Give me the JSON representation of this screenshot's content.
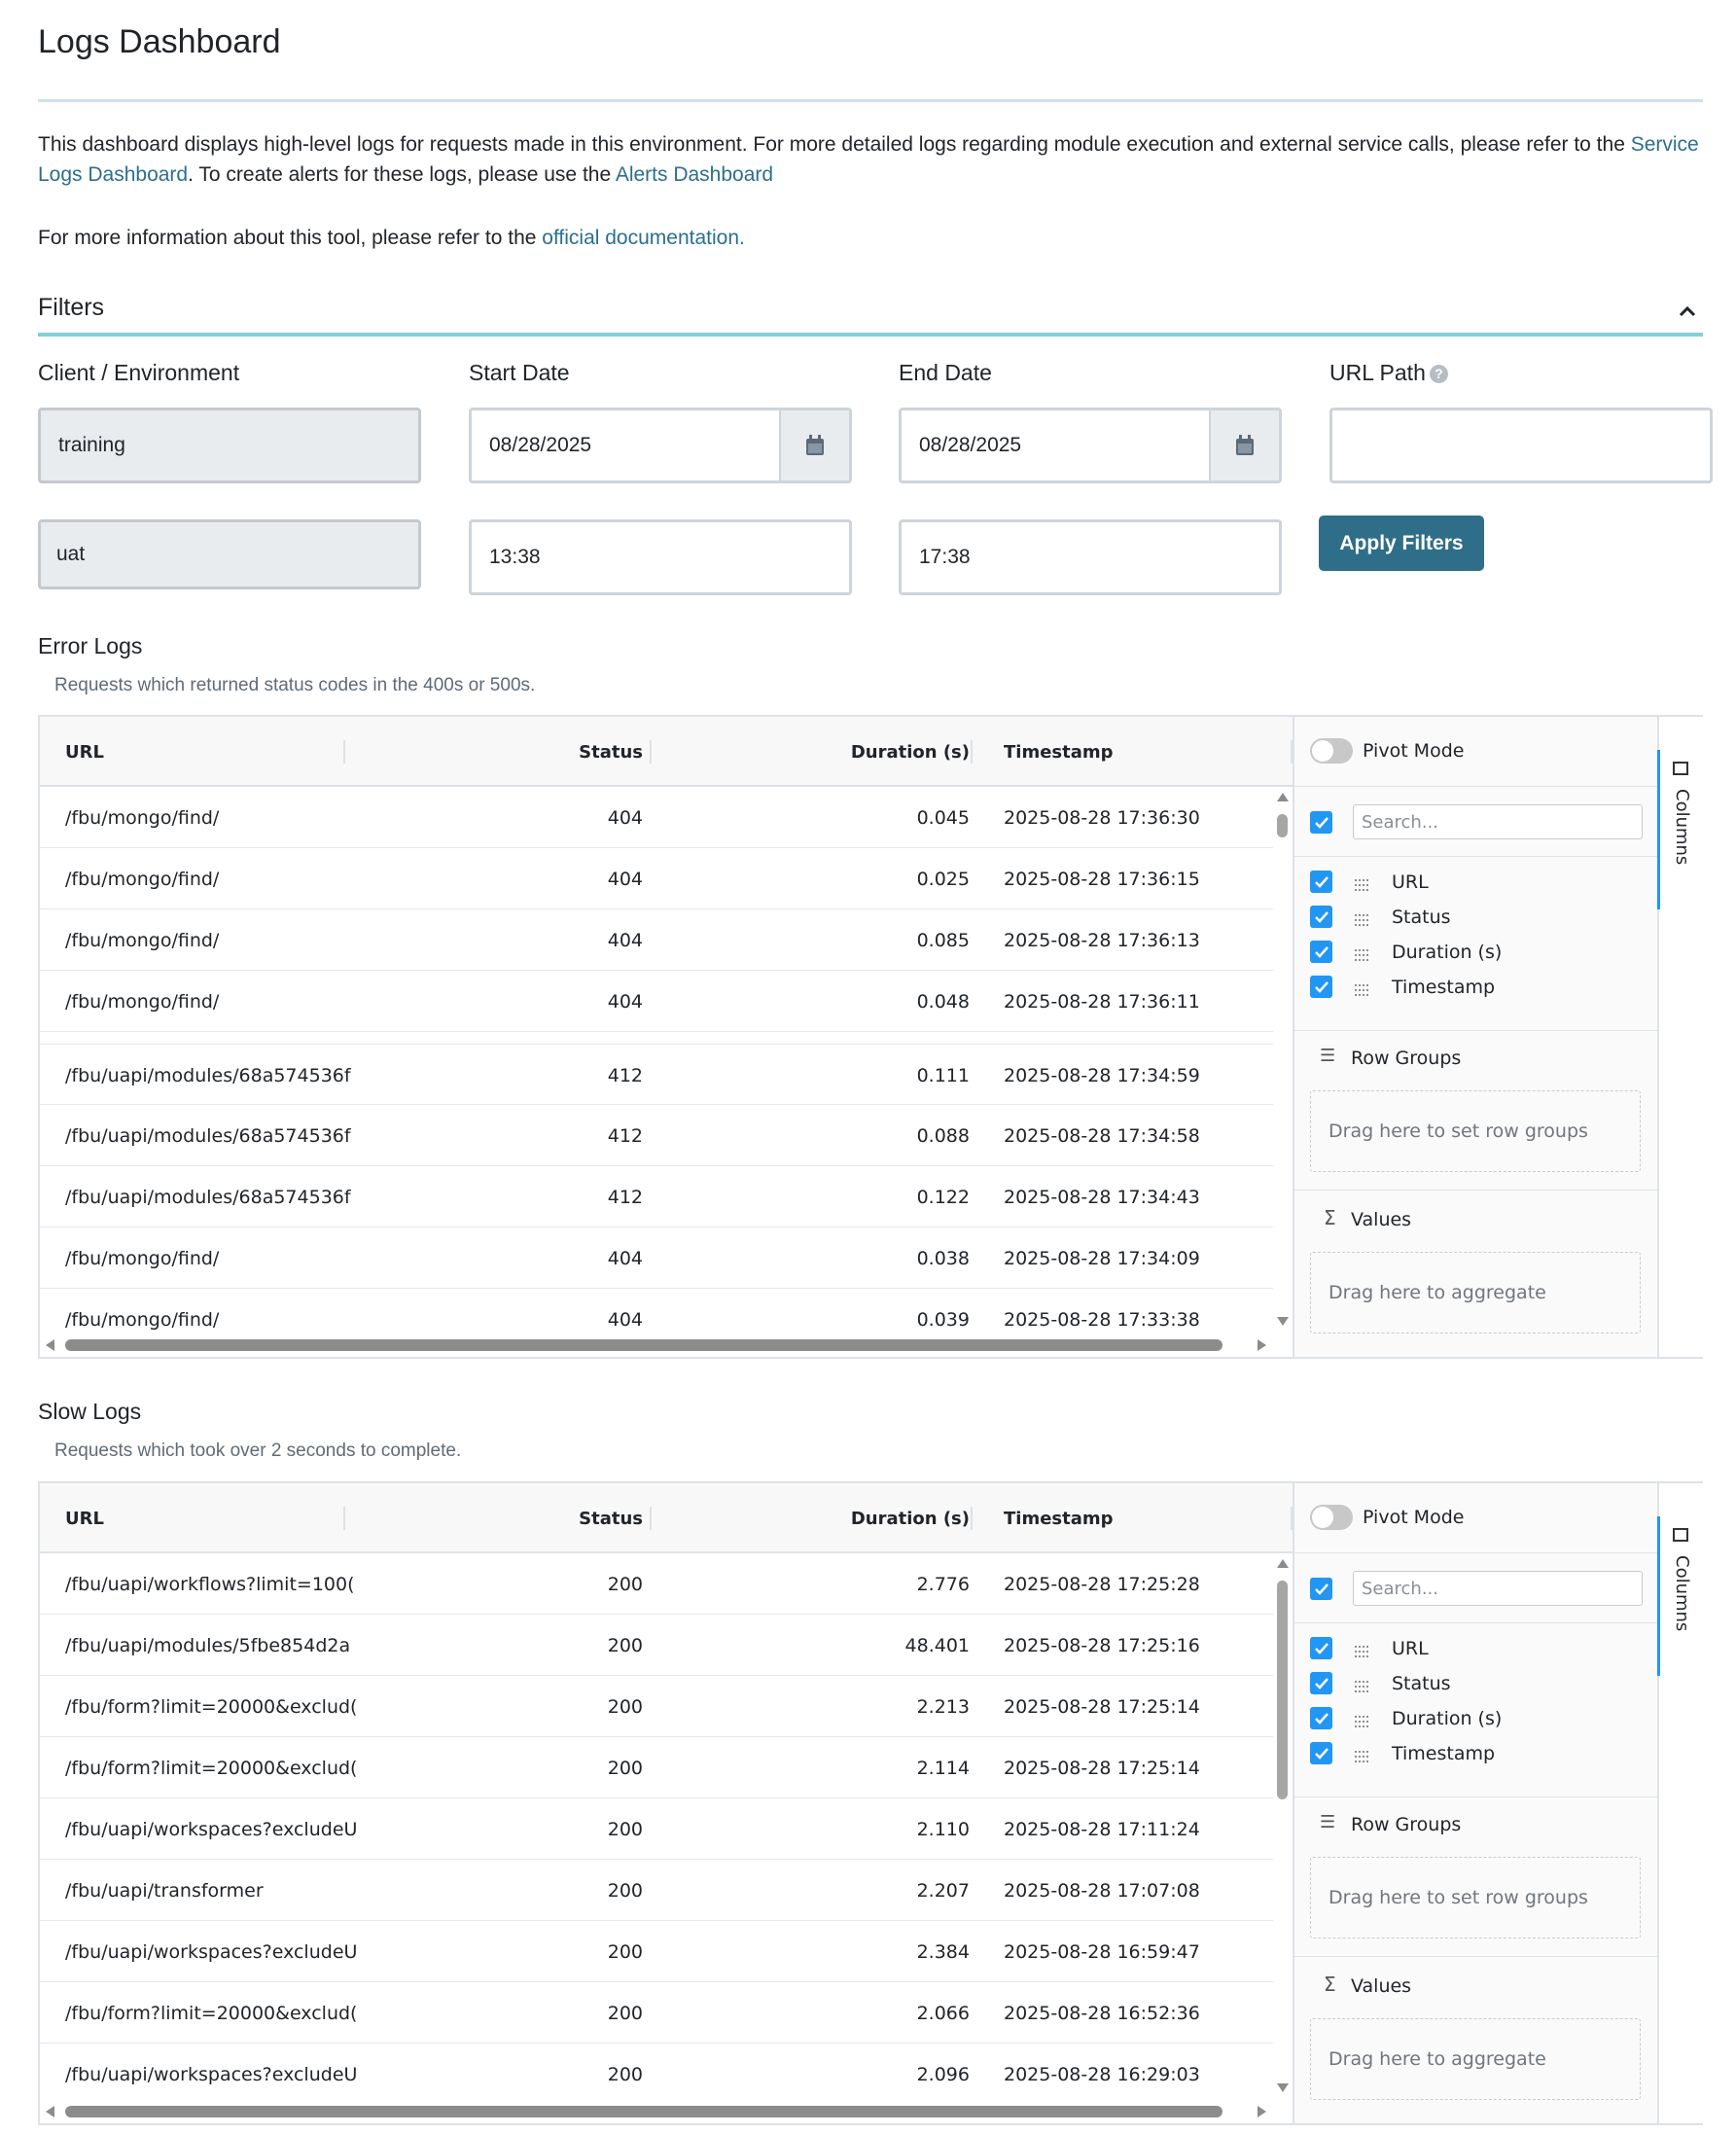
{
  "page": {
    "title": "Logs Dashboard",
    "intro_prefix": "This dashboard displays high-level logs for requests made in this environment. For more detailed logs regarding module execution and external service calls, please refer to the ",
    "service_logs_link": "Service Logs Dashboard",
    "intro_middle": ". To create alerts for these logs, please use the ",
    "alerts_link": "Alerts Dashboard",
    "info_prefix": "For more information about this tool, please refer to the ",
    "docs_link": "official documentation",
    "info_suffix": "."
  },
  "filters": {
    "title": "Filters",
    "client_label": "Client / Environment",
    "client_value": "training",
    "env_value": "uat",
    "start_label": "Start Date",
    "start_date": "08/28/2025",
    "start_time": "13:38",
    "end_label": "End Date",
    "end_date": "08/28/2025",
    "end_time": "17:38",
    "url_label": "URL Path",
    "url_value": "",
    "apply_label": "Apply Filters"
  },
  "columns": {
    "url": "URL",
    "status": "Status",
    "duration": "Duration (s)",
    "timestamp": "Timestamp"
  },
  "side_panel": {
    "pivot_mode": "Pivot Mode",
    "search_placeholder": "Search...",
    "columns": [
      "URL",
      "Status",
      "Duration (s)",
      "Timestamp"
    ],
    "row_groups": "Row Groups",
    "row_groups_drop": "Drag here to set row groups",
    "values": "Values",
    "values_drop": "Drag here to aggregate",
    "tab_label": "Columns"
  },
  "error_logs": {
    "title": "Error Logs",
    "subtitle": "Requests which returned status codes in the 400s or 500s.",
    "rows": [
      {
        "url": "/fbu/mongo/find/",
        "status": "404",
        "duration": "0.045",
        "timestamp": "2025-08-28 17:36:30"
      },
      {
        "url": "/fbu/mongo/find/",
        "status": "404",
        "duration": "0.025",
        "timestamp": "2025-08-28 17:36:15"
      },
      {
        "url": "/fbu/mongo/find/",
        "status": "404",
        "duration": "0.085",
        "timestamp": "2025-08-28 17:36:13"
      },
      {
        "url": "/fbu/mongo/find/",
        "status": "404",
        "duration": "0.048",
        "timestamp": "2025-08-28 17:36:11"
      },
      {
        "url": "/fbu/uapi/modules/68a574536f",
        "status": "412",
        "duration": "0.111",
        "timestamp": "2025-08-28 17:34:59"
      },
      {
        "url": "/fbu/uapi/modules/68a574536f",
        "status": "412",
        "duration": "0.088",
        "timestamp": "2025-08-28 17:34:58"
      },
      {
        "url": "/fbu/uapi/modules/68a574536f",
        "status": "412",
        "duration": "0.122",
        "timestamp": "2025-08-28 17:34:43"
      },
      {
        "url": "/fbu/mongo/find/",
        "status": "404",
        "duration": "0.038",
        "timestamp": "2025-08-28 17:34:09"
      },
      {
        "url": "/fbu/mongo/find/",
        "status": "404",
        "duration": "0.039",
        "timestamp": "2025-08-28 17:33:38"
      }
    ]
  },
  "slow_logs": {
    "title": "Slow Logs",
    "subtitle": "Requests which took over 2 seconds to complete.",
    "rows": [
      {
        "url": "/fbu/uapi/workflows?limit=100(",
        "status": "200",
        "duration": "2.776",
        "timestamp": "2025-08-28 17:25:28"
      },
      {
        "url": "/fbu/uapi/modules/5fbe854d2a",
        "status": "200",
        "duration": "48.401",
        "timestamp": "2025-08-28 17:25:16"
      },
      {
        "url": "/fbu/form?limit=20000&exclud(",
        "status": "200",
        "duration": "2.213",
        "timestamp": "2025-08-28 17:25:14"
      },
      {
        "url": "/fbu/form?limit=20000&exclud(",
        "status": "200",
        "duration": "2.114",
        "timestamp": "2025-08-28 17:25:14"
      },
      {
        "url": "/fbu/uapi/workspaces?excludeU",
        "status": "200",
        "duration": "2.110",
        "timestamp": "2025-08-28 17:11:24"
      },
      {
        "url": "/fbu/uapi/transformer",
        "status": "200",
        "duration": "2.207",
        "timestamp": "2025-08-28 17:07:08"
      },
      {
        "url": "/fbu/uapi/workspaces?excludeU",
        "status": "200",
        "duration": "2.384",
        "timestamp": "2025-08-28 16:59:47"
      },
      {
        "url": "/fbu/form?limit=20000&exclud(",
        "status": "200",
        "duration": "2.066",
        "timestamp": "2025-08-28 16:52:36"
      },
      {
        "url": "/fbu/uapi/workspaces?excludeU",
        "status": "200",
        "duration": "2.096",
        "timestamp": "2025-08-28 16:29:03"
      }
    ]
  },
  "colors": {
    "accent": "#2f6e89",
    "link": "#2c6e8f",
    "checkbox": "#2196f3",
    "rule": "#7fd1dc"
  }
}
